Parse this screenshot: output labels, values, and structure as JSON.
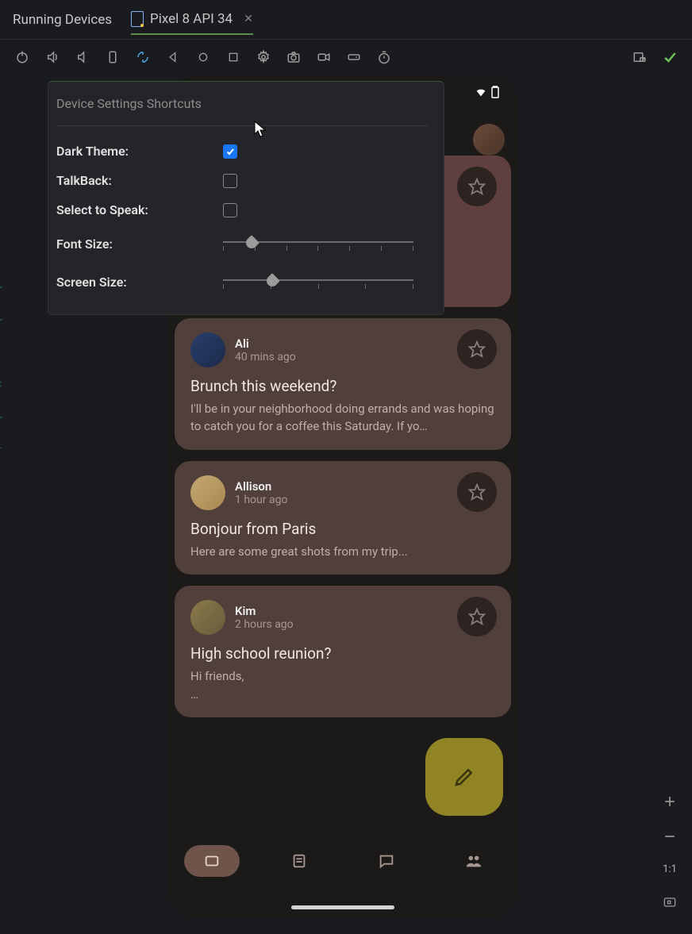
{
  "tabs": {
    "running_devices": "Running Devices",
    "device_name": "Pixel 8 API 34"
  },
  "settings": {
    "title": "Device Settings Shortcuts",
    "dark_theme": {
      "label": "Dark Theme:",
      "checked": true
    },
    "talkback": {
      "label": "TalkBack:",
      "checked": false
    },
    "select_to_speak": {
      "label": "Select to Speak:",
      "checked": false
    },
    "font_size": {
      "label": "Font Size:",
      "position_pct": 15,
      "ticks": 7
    },
    "screen_size": {
      "label": "Screen Size:",
      "position_pct": 26,
      "ticks": 5
    }
  },
  "emails": [
    {
      "name": "",
      "time": "",
      "subject": "",
      "body": "…"
    },
    {
      "name": "Ali",
      "time": "40 mins ago",
      "subject": "Brunch this weekend?",
      "body": "I'll be in your neighborhood doing errands and was hoping to catch you for a coffee this Saturday. If yo…"
    },
    {
      "name": "Allison",
      "time": "1 hour ago",
      "subject": "Bonjour from Paris",
      "body": "Here are some great shots from my trip..."
    },
    {
      "name": "Kim",
      "time": "2 hours ago",
      "subject": "High school reunion?",
      "body": "Hi friends,\n…"
    }
  ],
  "right_panel": {
    "zoom_label": "1:1"
  },
  "colors": {
    "card_bg": "#513f3c",
    "card_bg_first": "#60403e",
    "fab_bg": "#918424",
    "checkbox_blue": "#1976f5",
    "nav_active": "#6e544b"
  }
}
